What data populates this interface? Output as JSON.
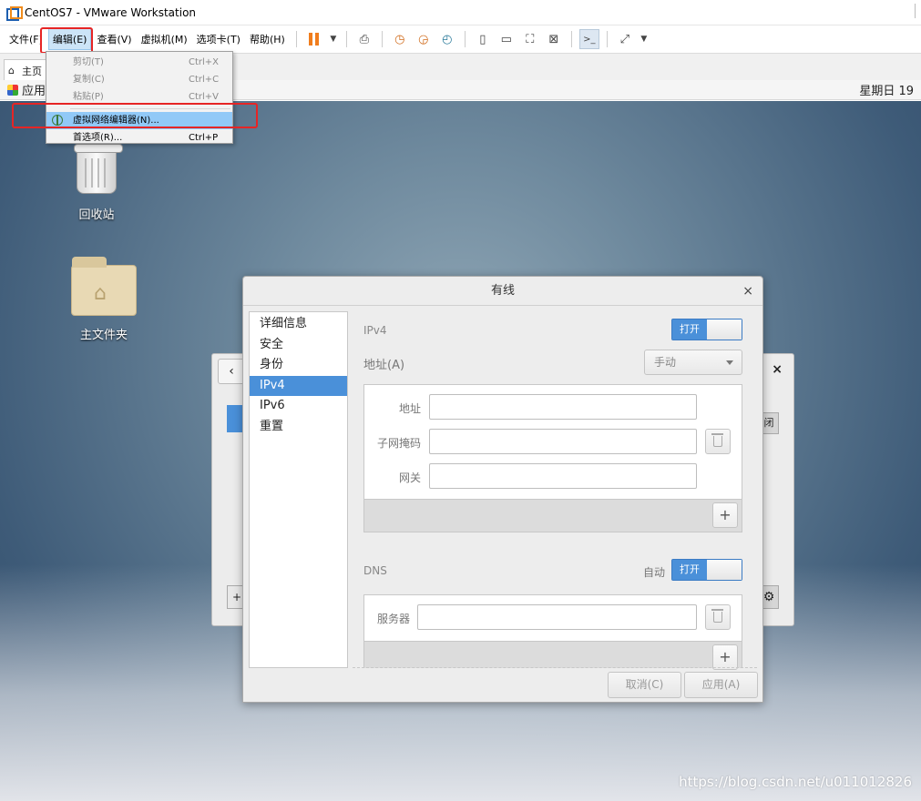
{
  "window": {
    "title": "CentOS7 - VMware Workstation"
  },
  "menubar": {
    "items": [
      {
        "label": "文件(F)"
      },
      {
        "label": "编辑(E)",
        "active": true
      },
      {
        "label": "查看(V)"
      },
      {
        "label": "虚拟机(M)"
      },
      {
        "label": "选项卡(T)"
      },
      {
        "label": "帮助(H)"
      }
    ],
    "toolbar_icons": [
      "pause-icon",
      "dropdown-arrow-icon",
      "send-ctrl-alt-del-icon",
      "snapshot-icon",
      "revert-snapshot-icon",
      "snapshot-manager-icon",
      "sidebar-view-icon",
      "thumbnail-view-icon",
      "fullscreen-icon",
      "unity-icon",
      "console-view-icon",
      "stretch-icon",
      "dropdown-arrow-icon"
    ]
  },
  "edit_menu": {
    "items": [
      {
        "label": "剪切(T)",
        "shortcut": "Ctrl+X",
        "enabled": false
      },
      {
        "label": "复制(C)",
        "shortcut": "Ctrl+C",
        "enabled": false
      },
      {
        "label": "粘贴(P)",
        "shortcut": "Ctrl+V",
        "enabled": false
      },
      {
        "label": "虚拟网络编辑器(N)...",
        "shortcut": "",
        "enabled": true,
        "highlighted": true,
        "icon": "network-icon"
      },
      {
        "label": "首选项(R)...",
        "shortcut": "Ctrl+P",
        "enabled": true
      }
    ]
  },
  "tabs": {
    "home": "主页"
  },
  "gnome_bar": {
    "apps_label": "应用",
    "clock": "星期日 19"
  },
  "desktop": {
    "icons": [
      {
        "label": "回收站"
      },
      {
        "label": "主文件夹"
      }
    ]
  },
  "background_dialog": {
    "close_button_text": "闭"
  },
  "dialog": {
    "title": "有线",
    "sidebar": [
      {
        "label": "详细信息"
      },
      {
        "label": "安全"
      },
      {
        "label": "身份"
      },
      {
        "label": "IPv4",
        "selected": true
      },
      {
        "label": "IPv6"
      },
      {
        "label": "重置"
      }
    ],
    "ipv4": {
      "section_label": "IPv4",
      "toggle_label": "打开",
      "address_label": "地址(A)",
      "method_value": "手动",
      "fields": {
        "address": "地址",
        "netmask": "子网掩码",
        "gateway": "网关"
      }
    },
    "dns": {
      "section_label": "DNS",
      "auto_label": "自动",
      "toggle_label": "打开",
      "server_label": "服务器"
    },
    "footer": {
      "cancel": "取消(C)",
      "apply": "应用(A)"
    }
  },
  "watermark": "https://blog.csdn.net/u011012826",
  "colors": {
    "accent": "#4a90d9",
    "highlight_box": "#e62525",
    "menu_hover": "#91c9f7"
  }
}
